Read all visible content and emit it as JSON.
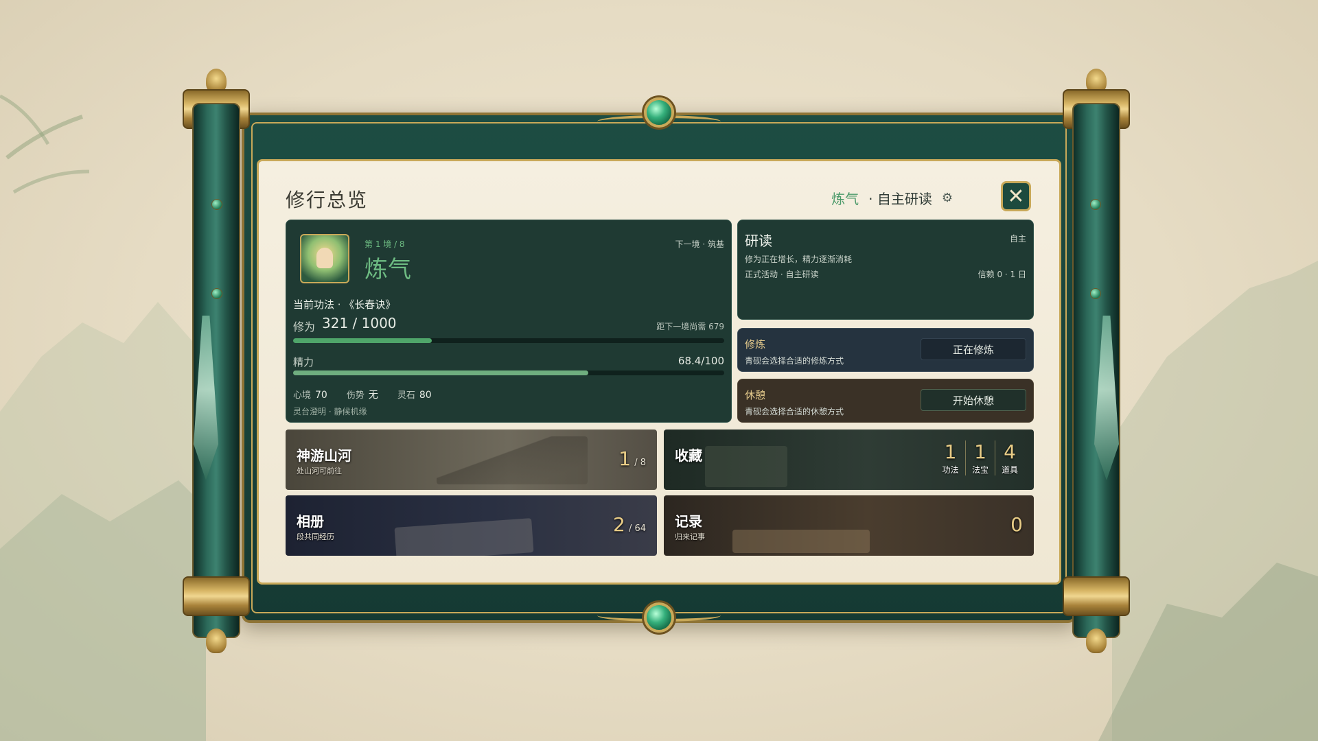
{
  "header": {
    "title": "修行总览",
    "realm_tag": "炼气",
    "mode_tag": "· 自主研读"
  },
  "icons": {
    "settings": "gear-icon",
    "close": "close-icon"
  },
  "status": {
    "stage": "第 1 境 / 8",
    "realm": "炼气",
    "next_realm": "下一境 · 筑基",
    "technique": "当前功法 · 《长春诀》",
    "cultivation_label": "修为",
    "cultivation_value": "321 / 1000",
    "cultivation_progress": 0.321,
    "cultivation_need": "距下一境尚需 679",
    "energy_label": "精力",
    "energy_value": "68.4/100",
    "energy_progress": 0.684,
    "stats": [
      {
        "label": "心境",
        "value": "70"
      },
      {
        "label": "伤势",
        "value": "无"
      },
      {
        "label": "灵石",
        "value": "80"
      }
    ],
    "status_line": "灵台澄明 · 静候机缘"
  },
  "study": {
    "title": "研读",
    "auto": "自主",
    "desc": "修为正在增长，精力逐渐消耗",
    "activity": "正式活动 · 自主研读",
    "reliance": "信赖 0 · 1 日"
  },
  "options": {
    "cultivate": {
      "title": "修炼",
      "desc": "青砚会选择合适的修炼方式",
      "button": "正在修炼"
    },
    "rest": {
      "title": "休憩",
      "desc": "青砚会选择合适的休憩方式",
      "button": "开始休憩"
    }
  },
  "tiles": {
    "travel": {
      "name": "神游山河",
      "sub": "处山河可前往",
      "count": "1",
      "total": "/ 8"
    },
    "collection": {
      "name": "收藏",
      "items": [
        {
          "num": "1",
          "label": "功法"
        },
        {
          "num": "1",
          "label": "法宝"
        },
        {
          "num": "4",
          "label": "道具"
        }
      ]
    },
    "album": {
      "name": "相册",
      "sub": "段共同经历",
      "count": "2",
      "total": "/ 64"
    },
    "record": {
      "name": "记录",
      "sub": "归来记事",
      "count": "0"
    }
  },
  "colors": {
    "accent_green": "#6dbb82",
    "gold": "#c9a959",
    "panel": "#1f3a33"
  }
}
